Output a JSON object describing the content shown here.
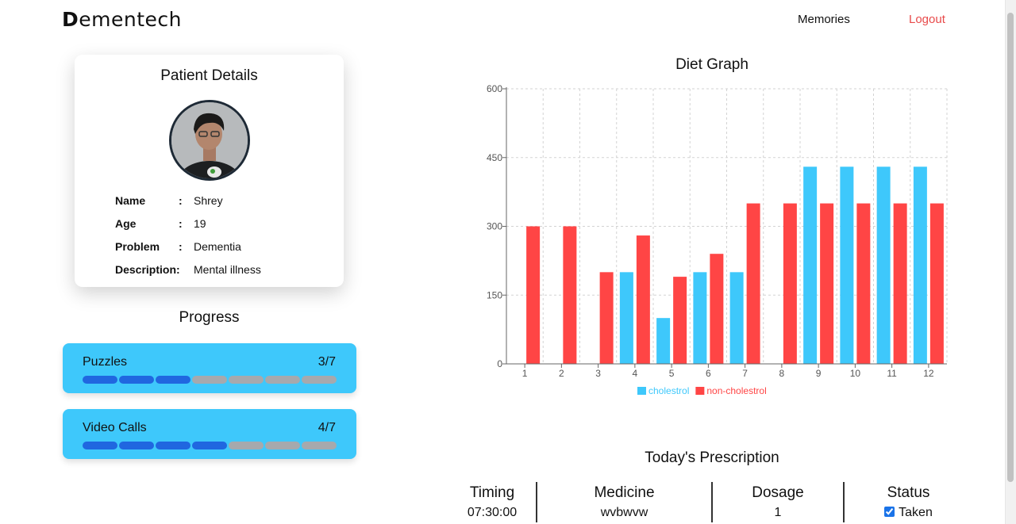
{
  "header": {
    "brand_first": "D",
    "brand_rest": "ementech",
    "nav": {
      "memories": "Memories",
      "logout": "Logout"
    }
  },
  "patient": {
    "title": "Patient Details",
    "fields": [
      {
        "label": "Name",
        "value": "Shrey"
      },
      {
        "label": "Age",
        "value": "19"
      },
      {
        "label": "Problem",
        "value": "Dementia"
      },
      {
        "label": "Description:",
        "value": "Mental illness"
      }
    ],
    "colon": ":"
  },
  "progress": {
    "title": "Progress",
    "items": [
      {
        "label": "Puzzles",
        "count": "3/7",
        "done": 3,
        "total": 7
      },
      {
        "label": "Video Calls",
        "count": "4/7",
        "done": 4,
        "total": 7
      }
    ]
  },
  "colors": {
    "accent_progress": "#3ec8fb",
    "segment_done": "#2067e0",
    "segment_todo": "#a6a9ad",
    "logout": "#e84a4a",
    "series_cholestrol": "#3ec8fb",
    "series_non_cholestrol": "#ff4545"
  },
  "chart_data": {
    "type": "bar",
    "title": "Diet Graph",
    "categories": [
      "1",
      "2",
      "3",
      "4",
      "5",
      "6",
      "7",
      "8",
      "9",
      "10",
      "11",
      "12"
    ],
    "series": [
      {
        "name": "cholestrol",
        "color": "#3ec8fb",
        "values": [
          0,
          0,
          0,
          200,
          100,
          200,
          200,
          0,
          430,
          430,
          430,
          430
        ]
      },
      {
        "name": "non-cholestrol",
        "color": "#ff4545",
        "values": [
          300,
          300,
          200,
          280,
          190,
          240,
          350,
          350,
          350,
          350,
          350,
          350
        ]
      }
    ],
    "ylim": [
      0,
      600
    ],
    "yticks": [
      0,
      150,
      300,
      450,
      600
    ],
    "grid": true,
    "legend": "bottom-center"
  },
  "prescription": {
    "title": "Today's Prescription",
    "headers": [
      "Timing",
      "Medicine",
      "Dosage",
      "Status"
    ],
    "rows": [
      {
        "timing": "07:30:00",
        "medicine": "wvbwvw",
        "dosage": "1",
        "status": "Taken",
        "checked": true
      }
    ]
  }
}
